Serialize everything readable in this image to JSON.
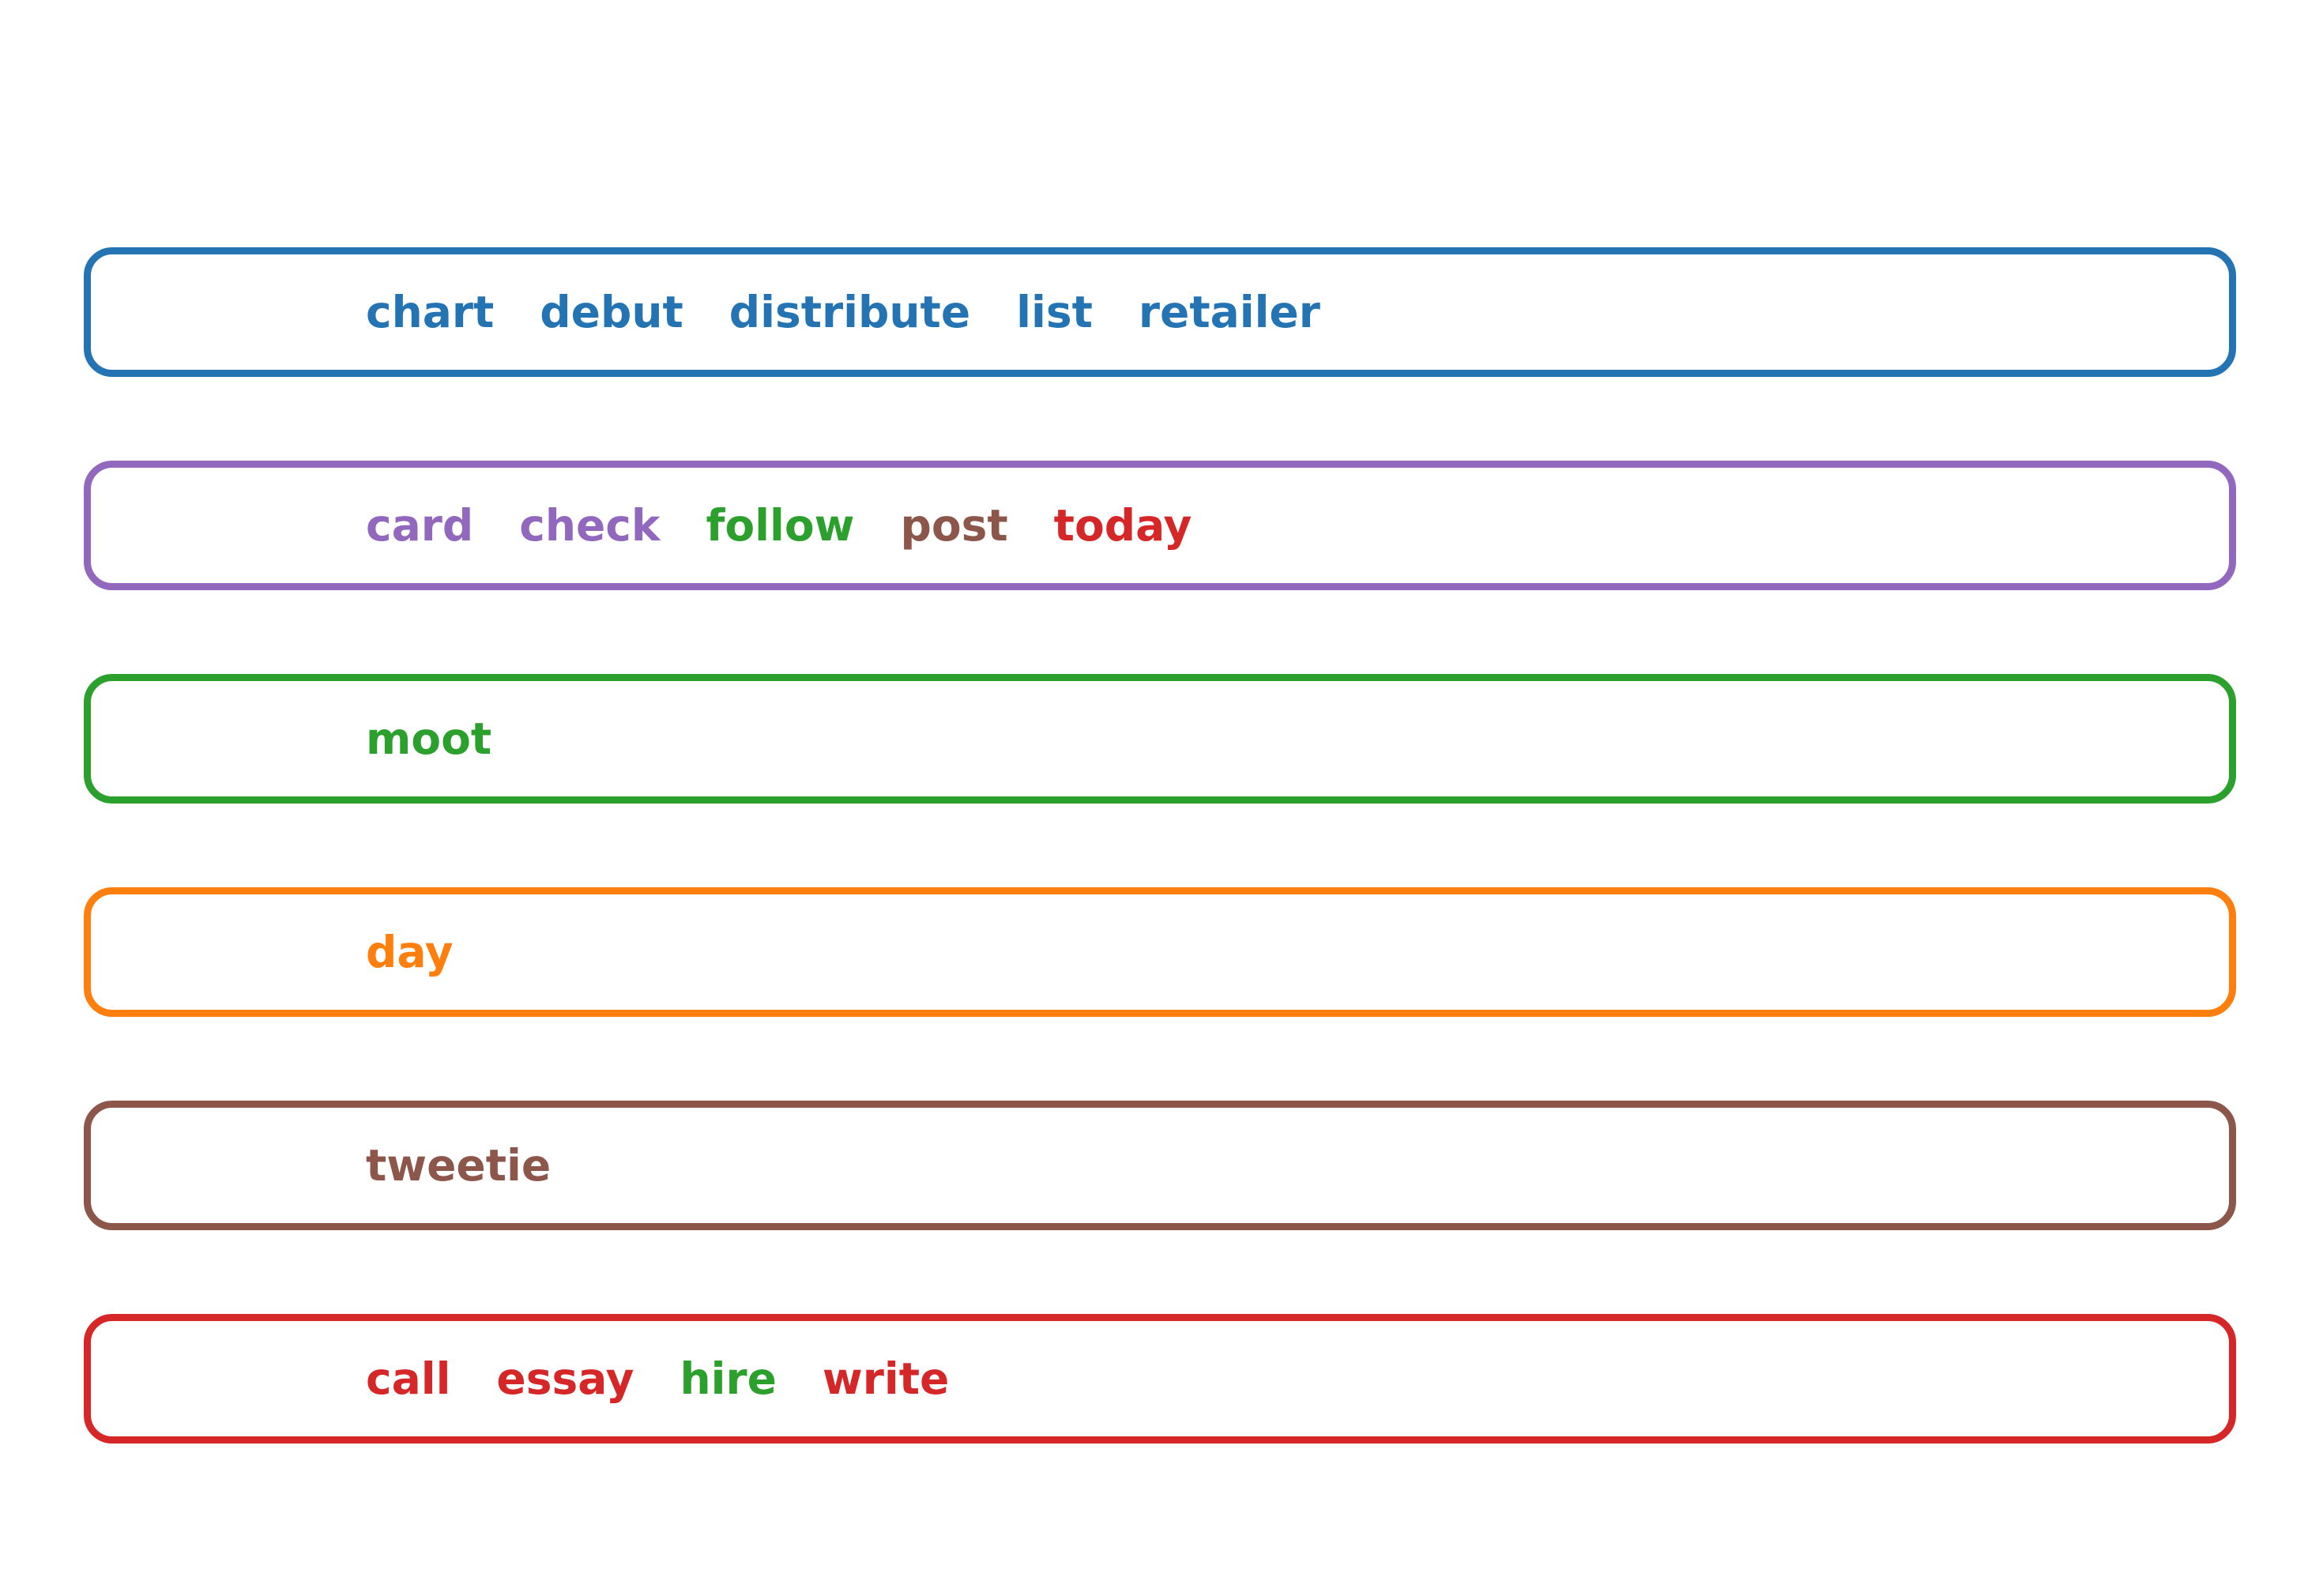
{
  "colors": {
    "blue": "#2474b4",
    "purple": "#9168bd",
    "green": "#2ca02c",
    "orange": "#ff7f0e",
    "brown": "#8c564b",
    "red": "#d62728"
  },
  "groups": [
    {
      "border_color": "#2474b4",
      "words": [
        {
          "text": "chart",
          "color": "#2474b4"
        },
        {
          "text": "debut",
          "color": "#2474b4"
        },
        {
          "text": "distribute",
          "color": "#2474b4"
        },
        {
          "text": "list",
          "color": "#2474b4"
        },
        {
          "text": "retailer",
          "color": "#2474b4"
        }
      ]
    },
    {
      "border_color": "#9168bd",
      "words": [
        {
          "text": "card",
          "color": "#9168bd"
        },
        {
          "text": "check",
          "color": "#9168bd"
        },
        {
          "text": "follow",
          "color": "#2ca02c"
        },
        {
          "text": "post",
          "color": "#8c564b"
        },
        {
          "text": "today",
          "color": "#d62728"
        }
      ]
    },
    {
      "border_color": "#2ca02c",
      "words": [
        {
          "text": "moot",
          "color": "#2ca02c"
        }
      ]
    },
    {
      "border_color": "#ff7f0e",
      "words": [
        {
          "text": "day",
          "color": "#ff7f0e"
        }
      ]
    },
    {
      "border_color": "#8c564b",
      "words": [
        {
          "text": "tweetie",
          "color": "#8c564b"
        }
      ]
    },
    {
      "border_color": "#d62728",
      "words": [
        {
          "text": "call",
          "color": "#d62728"
        },
        {
          "text": "essay",
          "color": "#d62728"
        },
        {
          "text": "hire",
          "color": "#2ca02c"
        },
        {
          "text": "write",
          "color": "#d62728"
        }
      ]
    }
  ]
}
